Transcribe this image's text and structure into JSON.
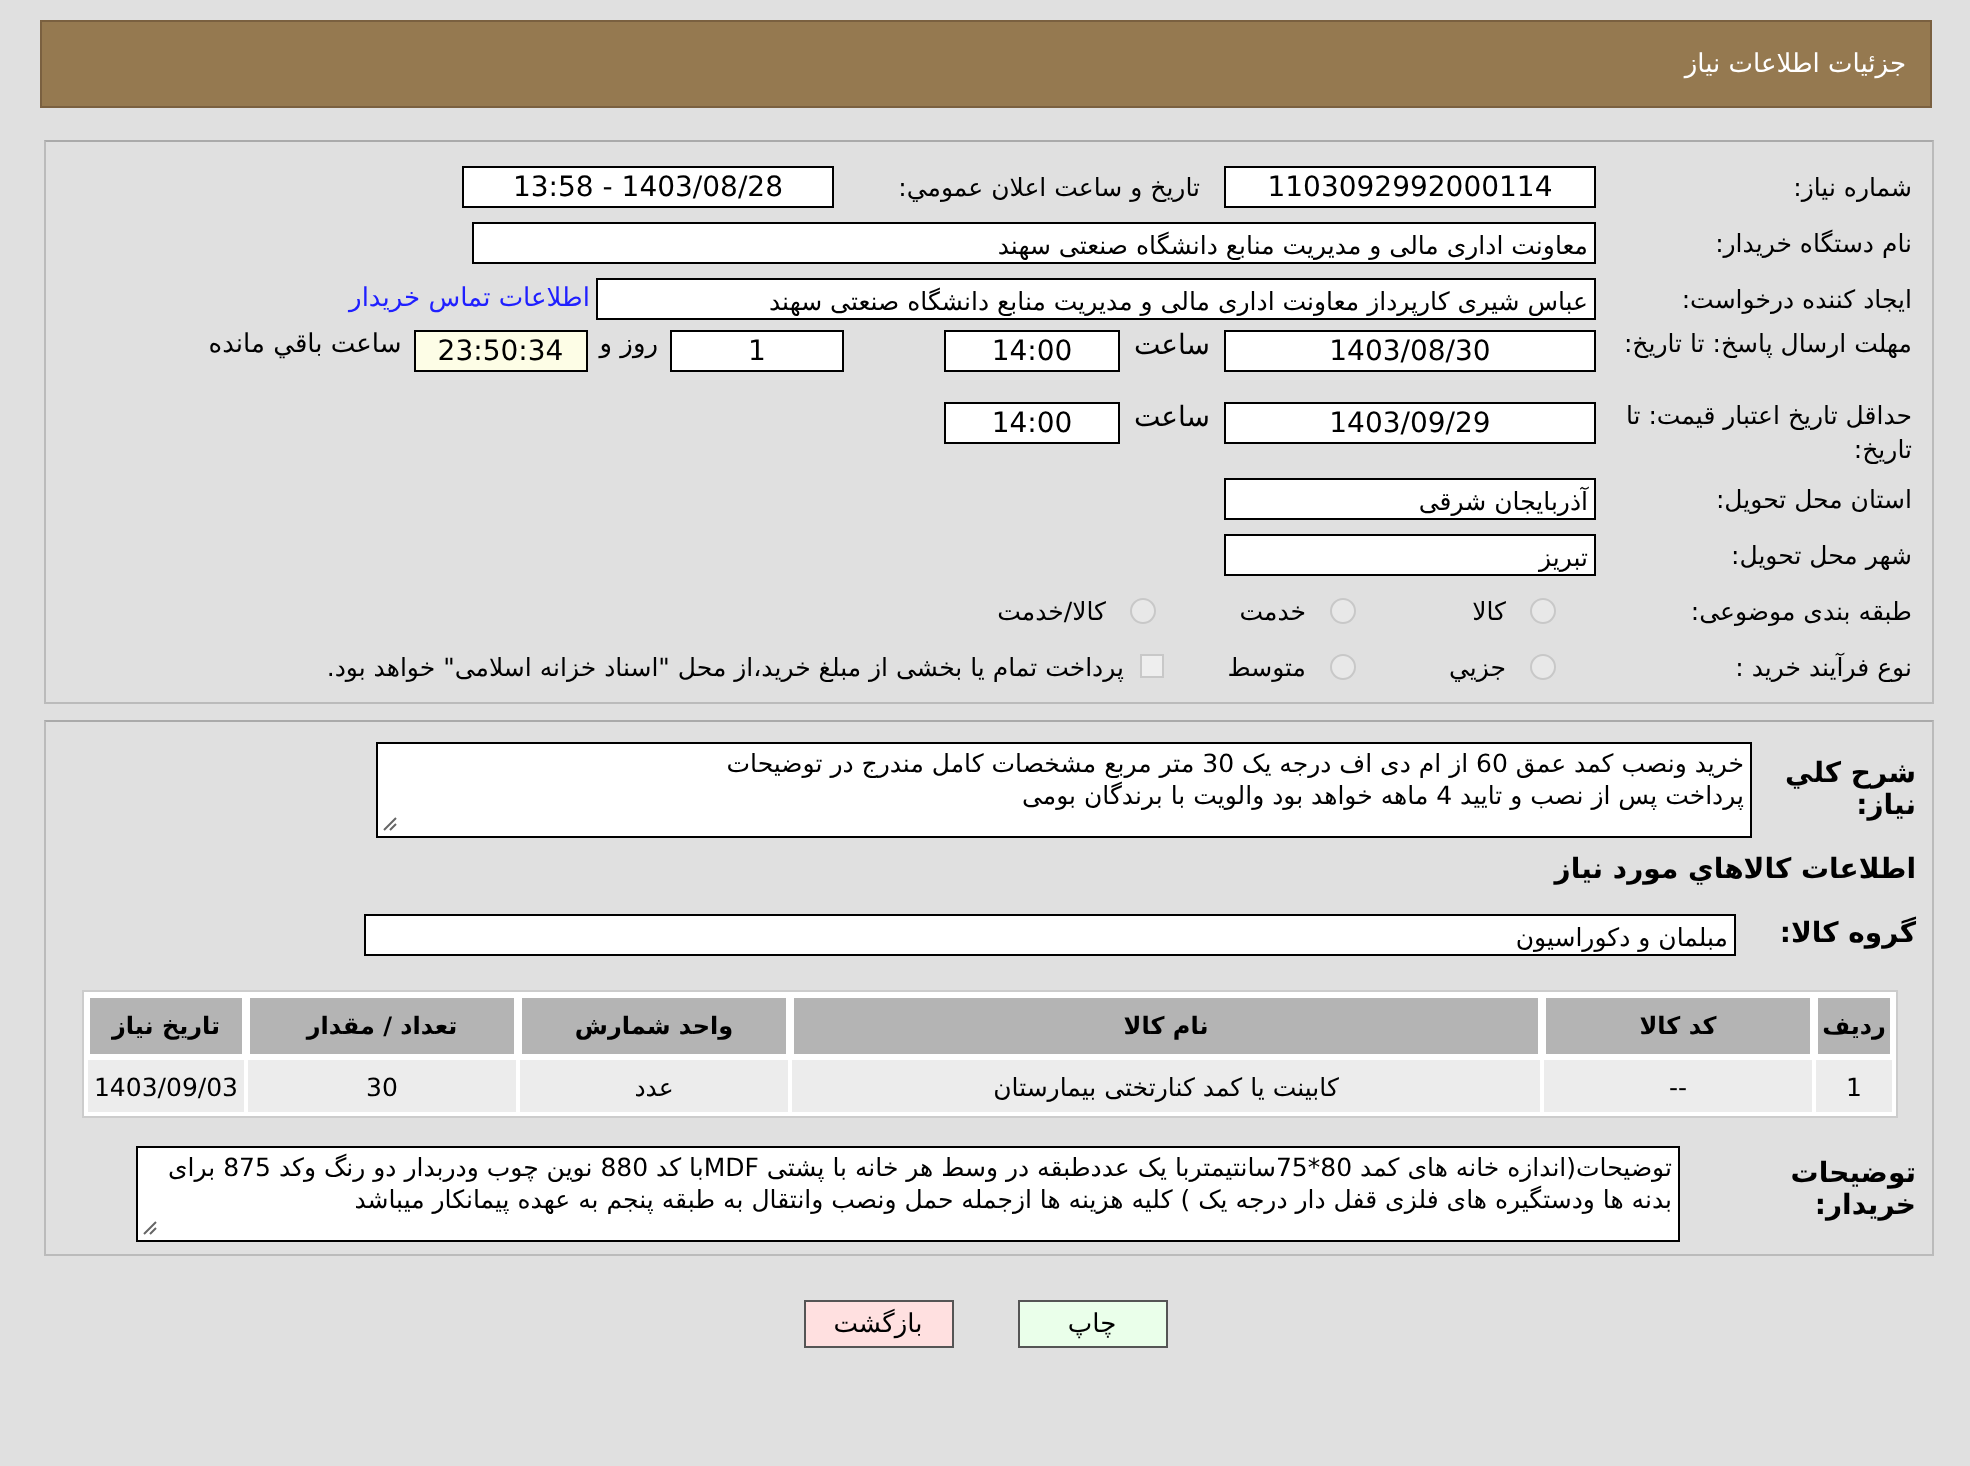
{
  "header": {
    "title": "جزئیات اطلاعات نیاز"
  },
  "need_number": {
    "label": "شماره نیاز:",
    "value": "1103092992000114"
  },
  "announce": {
    "label": "تاریخ و ساعت اعلان عمومي:",
    "value": "1403/08/28 - 13:58"
  },
  "buyer": {
    "label": "نام دستگاه خریدار:",
    "value": "معاونت اداری  مالی و مدیریت منابع دانشگاه صنعتی سهند"
  },
  "creator": {
    "label": "ایجاد کننده درخواست:",
    "value": "عباس شیری کارپرداز معاونت اداری  مالی و مدیریت منابع دانشگاه صنعتی سهند",
    "link": "اطلاعات تماس خریدار"
  },
  "deadline": {
    "label": "مهلت ارسال پاسخ: تا تاریخ:",
    "date": "1403/08/30",
    "time_label": "ساعت",
    "time": "14:00",
    "days": "1",
    "days_label": "روز و",
    "remaining": "23:50:34",
    "remaining_label": "ساعت باقي مانده"
  },
  "validity": {
    "label": "حداقل تاریخ اعتبار قیمت: تا تاریخ:",
    "date": "1403/09/29",
    "time_label": "ساعت",
    "time": "14:00"
  },
  "province": {
    "label": "استان محل تحویل:",
    "value": "آذربایجان شرقی"
  },
  "city": {
    "label": "شهر محل تحویل:",
    "value": "تبریز"
  },
  "category": {
    "label": "طبقه بندی موضوعی:",
    "options": [
      {
        "label": "کالا",
        "selected": false
      },
      {
        "label": "خدمت",
        "selected": false
      },
      {
        "label": "کالا/خدمت",
        "selected": false
      }
    ]
  },
  "process": {
    "label": "نوع فرآیند خرید :",
    "options": [
      {
        "label": "جزيي",
        "selected": false
      },
      {
        "label": "متوسط",
        "selected": false
      }
    ],
    "checkbox": {
      "checked": false
    },
    "note": "پرداخت تمام یا بخشی از مبلغ خرید،از محل \"اسناد خزانه اسلامی\" خواهد بود."
  },
  "summary": {
    "label": "شرح کلي نیاز:",
    "lines": [
      "خرید ونصب کمد عمق 60 از ام دی اف درجه یک 30 متر مربع مشخصات کامل مندرج در توضیحات",
      "پرداخت پس از نصب و تایید 4 ماهه خواهد بود والویت با برندگان بومی"
    ]
  },
  "goods_title": "اطلاعات کالاهاي مورد نیاز",
  "goods_group": {
    "label": "گروه کالا:",
    "value": "مبلمان و دکوراسیون"
  },
  "table": {
    "columns": [
      "ردیف",
      "کد کالا",
      "نام کالا",
      "واحد شمارش",
      "تعداد / مقدار",
      "تاریخ نیاز"
    ],
    "rows": [
      [
        "1",
        "--",
        "کابینت یا کمد کنارتختی بیمارستان",
        "عدد",
        "30",
        "1403/09/03"
      ]
    ]
  },
  "buyer_notes": {
    "label": "توضیحات خریدار:",
    "value": "توضیحات(اندازه خانه های کمد 80*75سانتیمتربا یک عددطبقه در وسط هر خانه با پشتی MDFبا کد 880 نوین چوب ودربدار دو رنگ وکد 875 برای بدنه ها ودستگیره های فلزی قفل دار درجه یک ) کلیه هزینه ها ازجمله حمل ونصب وانتقال به طبقه پنجم به عهده پیمانکار میباشد"
  },
  "buttons": [
    {
      "label": "چاپ",
      "kind": "print"
    },
    {
      "label": "بازگشت",
      "kind": "back"
    }
  ]
}
